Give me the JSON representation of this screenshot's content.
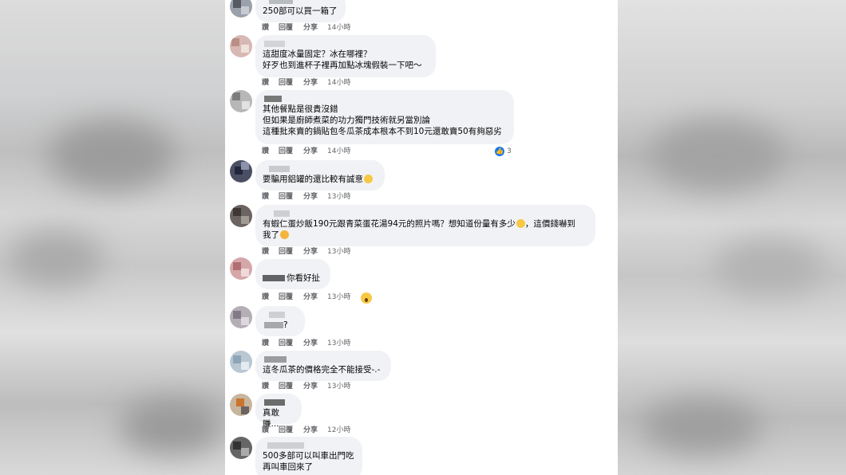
{
  "actions": {
    "like": "讚",
    "reply": "回覆",
    "share": "分享"
  },
  "comments": [
    {
      "text": "250部可以買一箱了",
      "time": "14小時"
    },
    {
      "text": "這甜度冰量固定？冰在哪裡？\n好歹也到進杯子裡再加點冰塊假裝一下吧～",
      "time": "14小時"
    },
    {
      "text": "其他餐點是很貴沒錯\n但如果是廚師煮菜的功力獨門技術就另當別論\n這種批來賣的鍋貼包冬瓜茶成本根本不到10元還敢賣50有夠惡劣",
      "time": "14小時",
      "likes": "3"
    },
    {
      "text": "要騙用鋁罐的還比較有誠意",
      "time": "13小時"
    },
    {
      "text": "有蝦仁蛋炒飯190元跟青菜蛋花湯94元的照片嗎？想知道份量有多少",
      "text2": "，這價錢嚇到\n我了",
      "time": "13小時"
    },
    {
      "text": "你看好扯",
      "time": "13小時"
    },
    {
      "text": "?",
      "time": "13小時"
    },
    {
      "text": "這冬瓜茶的價格完全不能接受-.-",
      "time": "13小時"
    },
    {
      "text": "真敢賺...",
      "time": "12小時"
    },
    {
      "text": "500多部可以叫車出門吃\n再叫車回來了",
      "time": ""
    }
  ],
  "colors": {
    "bubble": "#f0f2f5",
    "meta": "#65676b",
    "like": "#1877f2"
  }
}
